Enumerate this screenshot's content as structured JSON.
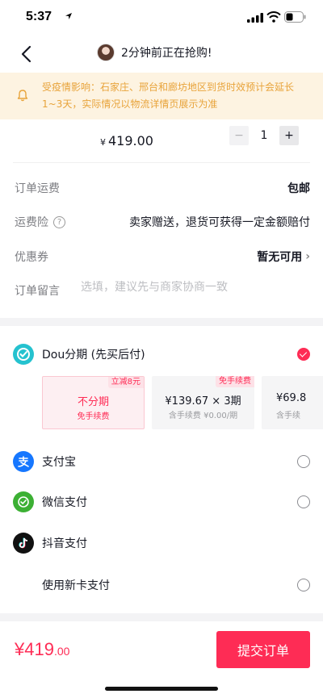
{
  "status_bar": {
    "time": "5:37"
  },
  "nav": {
    "title": "2分钟前正在抢购!"
  },
  "notice": {
    "text": "受疫情影响：石家庄、邢台和廊坊地区到货时效预计会延长1~3天，实际情况以物流详情页展示为准"
  },
  "product": {
    "price_symbol": "¥",
    "price": "419.00",
    "quantity": "1",
    "minus": "−",
    "plus": "+"
  },
  "rows": {
    "shipping": {
      "label": "订单运费",
      "value": "包邮"
    },
    "insurance": {
      "label": "运费险",
      "help": "?",
      "value": "卖家赠送，退货可获得一定金额赔付"
    },
    "coupon": {
      "label": "优惠券",
      "value": "暂无可用",
      "chevron": "›"
    },
    "remark": {
      "label": "订单留言",
      "placeholder": "选填，建议先与商家协商一致"
    }
  },
  "payment": {
    "dou": {
      "label": "Dou分期 (先买后付)",
      "selected": true
    },
    "plans": [
      {
        "tag": "立减8元",
        "title": "不分期",
        "sub": "免手续费"
      },
      {
        "tag": "免手续费",
        "title": "¥139.67 × 3期",
        "sub": "含手续费 ¥0.00/期"
      },
      {
        "tag": "",
        "title": "¥69.8",
        "sub": "含手续"
      }
    ],
    "alipay": {
      "label": "支付宝"
    },
    "wechat": {
      "label": "微信支付"
    },
    "douyin": {
      "label": "抖音支付"
    },
    "newcard": {
      "label": "使用新卡支付"
    }
  },
  "footer": {
    "symbol": "¥",
    "total_int": "419",
    "total_cents": ".00",
    "submit": "提交订单"
  },
  "colors": {
    "accent": "#fe2c55",
    "notice_text": "#e8a33a",
    "notice_bg": "#fdf3e1"
  }
}
